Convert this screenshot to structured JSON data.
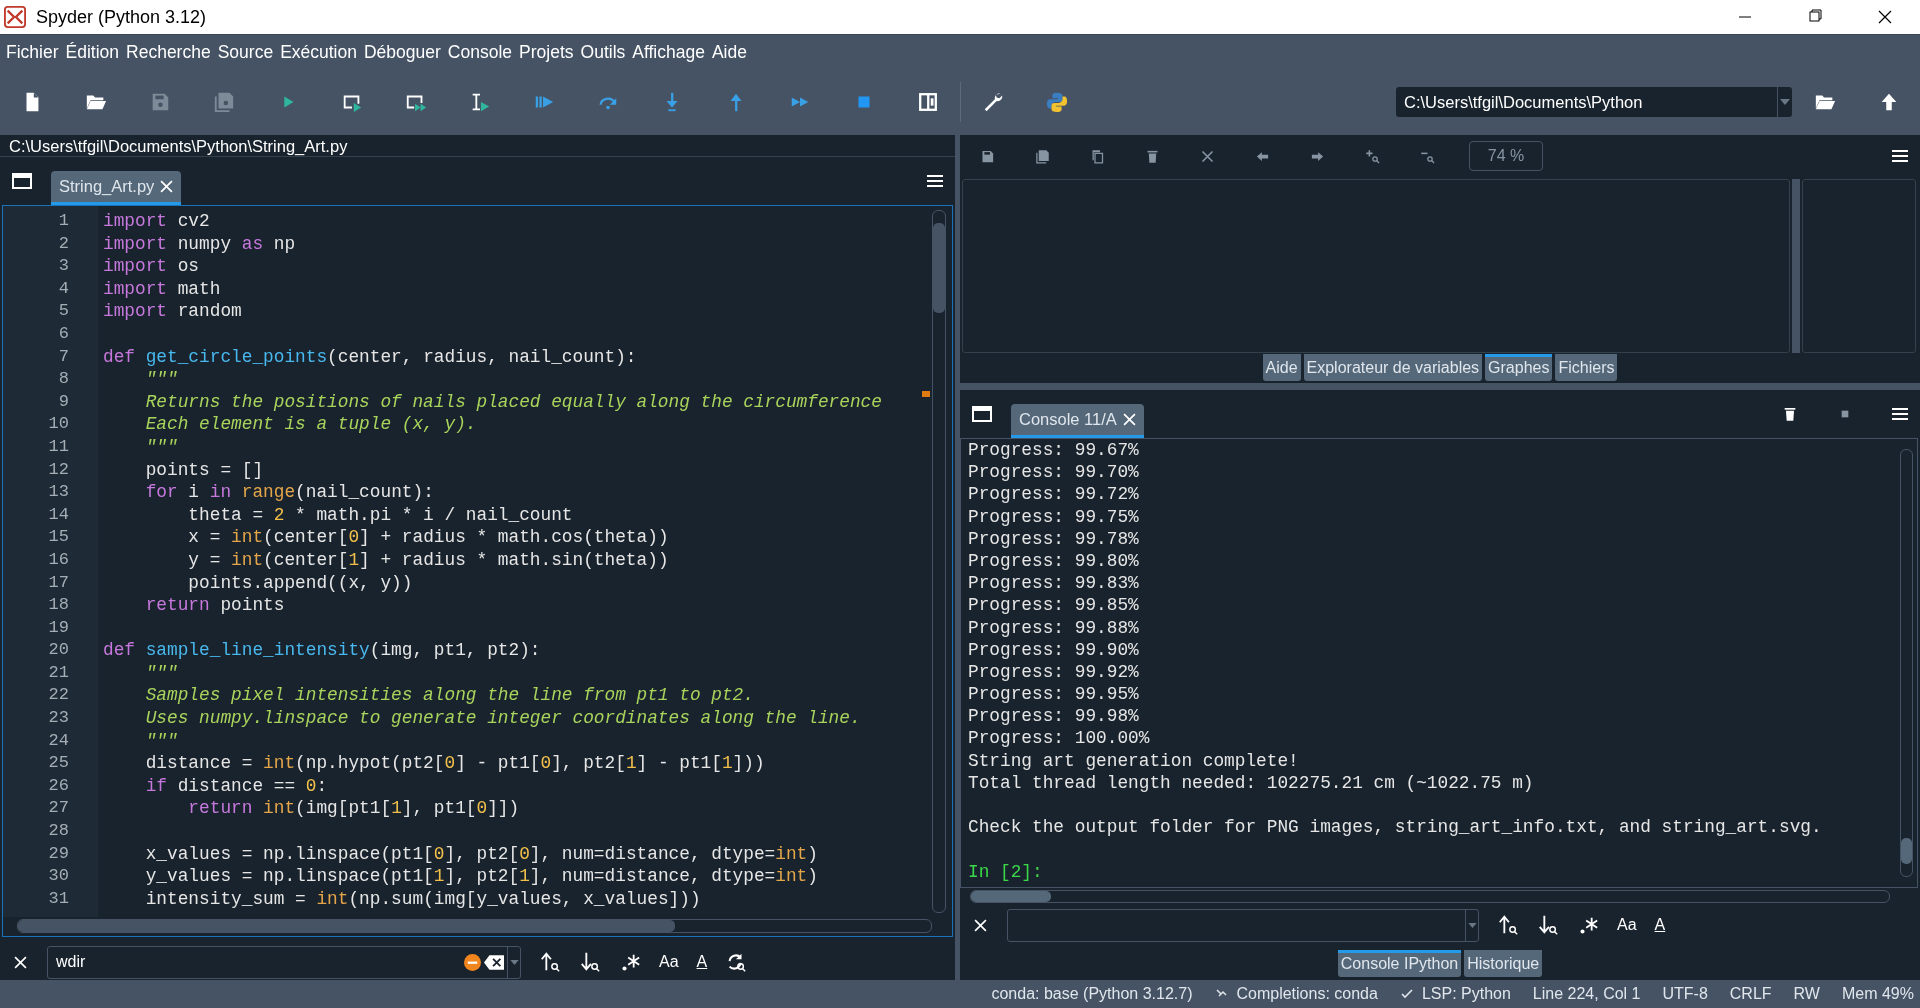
{
  "window": {
    "title": "Spyder (Python 3.12)"
  },
  "menu": [
    "Fichier",
    "Édition",
    "Recherche",
    "Source",
    "Exécution",
    "Déboguer",
    "Console",
    "Projets",
    "Outils",
    "Affichage",
    "Aide"
  ],
  "working_directory": {
    "value": "C:\\Users\\tfgil\\Documents\\Python"
  },
  "editor": {
    "path": "C:\\Users\\tfgil\\Documents\\Python\\String_Art.py",
    "tabs": [
      {
        "label": "String_Art.py",
        "selected": true
      }
    ],
    "lines": [
      {
        "n": "1",
        "tokens": [
          {
            "kind": "kw",
            "text": "import"
          },
          {
            "kind": "p",
            "text": " cv2"
          }
        ]
      },
      {
        "n": "2",
        "tokens": [
          {
            "kind": "kw",
            "text": "import"
          },
          {
            "kind": "p",
            "text": " numpy "
          },
          {
            "kind": "kw",
            "text": "as"
          },
          {
            "kind": "p",
            "text": " np"
          }
        ]
      },
      {
        "n": "3",
        "tokens": [
          {
            "kind": "kw",
            "text": "import"
          },
          {
            "kind": "p",
            "text": " os"
          }
        ]
      },
      {
        "n": "4",
        "tokens": [
          {
            "kind": "kw",
            "text": "import"
          },
          {
            "kind": "p",
            "text": " math"
          }
        ]
      },
      {
        "n": "5",
        "tokens": [
          {
            "kind": "kw",
            "text": "import"
          },
          {
            "kind": "p",
            "text": " random"
          }
        ]
      },
      {
        "n": "6"
      },
      {
        "n": "7",
        "tokens": [
          {
            "kind": "kw",
            "text": "def "
          },
          {
            "kind": "fn",
            "text": "get_circle_points"
          },
          {
            "kind": "p",
            "text": "(center, radius, nail_count):"
          }
        ]
      },
      {
        "n": "8",
        "tokens": [
          {
            "kind": "doc",
            "text": "    \"\"\""
          }
        ]
      },
      {
        "n": "9",
        "tokens": [
          {
            "kind": "doc",
            "text": "    Returns the positions of nails placed equally along the circumference"
          }
        ]
      },
      {
        "n": "10",
        "tokens": [
          {
            "kind": "doc",
            "text": "    Each element is a tuple (x, y)."
          }
        ]
      },
      {
        "n": "11",
        "tokens": [
          {
            "kind": "doc",
            "text": "    \"\"\""
          }
        ]
      },
      {
        "n": "12",
        "tokens": [
          {
            "kind": "p",
            "text": "    points = []"
          }
        ]
      },
      {
        "n": "13",
        "tokens": [
          {
            "kind": "kw",
            "text": "    for"
          },
          {
            "kind": "p",
            "text": " i "
          },
          {
            "kind": "kw",
            "text": "in"
          },
          {
            "kind": "bi",
            "text": " range"
          },
          {
            "kind": "p",
            "text": "(nail_count):"
          }
        ]
      },
      {
        "n": "14",
        "tokens": [
          {
            "kind": "p",
            "text": "        theta = "
          },
          {
            "kind": "num",
            "text": "2"
          },
          {
            "kind": "p",
            "text": " * math.pi * i / nail_count"
          }
        ]
      },
      {
        "n": "15",
        "tokens": [
          {
            "kind": "p",
            "text": "        x = "
          },
          {
            "kind": "bi",
            "text": "int"
          },
          {
            "kind": "p",
            "text": "(center["
          },
          {
            "kind": "num",
            "text": "0"
          },
          {
            "kind": "p",
            "text": "] + radius * math.cos(theta))"
          }
        ]
      },
      {
        "n": "16",
        "tokens": [
          {
            "kind": "p",
            "text": "        y = "
          },
          {
            "kind": "bi",
            "text": "int"
          },
          {
            "kind": "p",
            "text": "(center["
          },
          {
            "kind": "num",
            "text": "1"
          },
          {
            "kind": "p",
            "text": "] + radius * math.sin(theta))"
          }
        ]
      },
      {
        "n": "17",
        "tokens": [
          {
            "kind": "p",
            "text": "        points.append((x, y))"
          }
        ]
      },
      {
        "n": "18",
        "tokens": [
          {
            "kind": "kw",
            "text": "    return"
          },
          {
            "kind": "p",
            "text": " points"
          }
        ]
      },
      {
        "n": "19"
      },
      {
        "n": "20",
        "tokens": [
          {
            "kind": "kw",
            "text": "def "
          },
          {
            "kind": "fn",
            "text": "sample_line_intensity"
          },
          {
            "kind": "p",
            "text": "(img, pt1, pt2):"
          }
        ]
      },
      {
        "n": "21",
        "tokens": [
          {
            "kind": "doc",
            "text": "    \"\"\""
          }
        ]
      },
      {
        "n": "22",
        "tokens": [
          {
            "kind": "doc",
            "text": "    Samples pixel intensities along the line from pt1 to pt2."
          }
        ]
      },
      {
        "n": "23",
        "tokens": [
          {
            "kind": "doc",
            "text": "    Uses numpy.linspace to generate integer coordinates along the line."
          }
        ]
      },
      {
        "n": "24",
        "tokens": [
          {
            "kind": "doc",
            "text": "    \"\"\""
          }
        ]
      },
      {
        "n": "25",
        "tokens": [
          {
            "kind": "p",
            "text": "    distance = "
          },
          {
            "kind": "bi",
            "text": "int"
          },
          {
            "kind": "p",
            "text": "(np.hypot(pt2["
          },
          {
            "kind": "num",
            "text": "0"
          },
          {
            "kind": "p",
            "text": "] - pt1["
          },
          {
            "kind": "num",
            "text": "0"
          },
          {
            "kind": "p",
            "text": "], pt2["
          },
          {
            "kind": "num",
            "text": "1"
          },
          {
            "kind": "p",
            "text": "] - pt1["
          },
          {
            "kind": "num",
            "text": "1"
          },
          {
            "kind": "p",
            "text": "]))"
          }
        ]
      },
      {
        "n": "26",
        "tokens": [
          {
            "kind": "kw",
            "text": "    if"
          },
          {
            "kind": "p",
            "text": " distance == "
          },
          {
            "kind": "num",
            "text": "0"
          },
          {
            "kind": "p",
            "text": ":"
          }
        ]
      },
      {
        "n": "27",
        "tokens": [
          {
            "kind": "kw",
            "text": "        return"
          },
          {
            "kind": "bi",
            "text": " int"
          },
          {
            "kind": "p",
            "text": "(img[pt1["
          },
          {
            "kind": "num",
            "text": "1"
          },
          {
            "kind": "p",
            "text": "], pt1["
          },
          {
            "kind": "num",
            "text": "0"
          },
          {
            "kind": "p",
            "text": "]])"
          }
        ]
      },
      {
        "n": "28"
      },
      {
        "n": "29",
        "tokens": [
          {
            "kind": "p",
            "text": "    x_values = np.linspace(pt1["
          },
          {
            "kind": "num",
            "text": "0"
          },
          {
            "kind": "p",
            "text": "], pt2["
          },
          {
            "kind": "num",
            "text": "0"
          },
          {
            "kind": "p",
            "text": "], num=distance, dtype="
          },
          {
            "kind": "bi",
            "text": "int"
          },
          {
            "kind": "p",
            "text": ")"
          }
        ]
      },
      {
        "n": "30",
        "tokens": [
          {
            "kind": "p",
            "text": "    y_values = np.linspace(pt1["
          },
          {
            "kind": "num",
            "text": "1"
          },
          {
            "kind": "p",
            "text": "], pt2["
          },
          {
            "kind": "num",
            "text": "1"
          },
          {
            "kind": "p",
            "text": "], num=distance, dtype="
          },
          {
            "kind": "bi",
            "text": "int"
          },
          {
            "kind": "p",
            "text": ")"
          }
        ]
      },
      {
        "n": "31",
        "tokens": [
          {
            "kind": "p",
            "text": "    intensity_sum = "
          },
          {
            "kind": "bi",
            "text": "int"
          },
          {
            "kind": "p",
            "text": "(np.sum(img[y_values, x_values]))"
          }
        ]
      }
    ],
    "find": {
      "value": "wdir",
      "case_label": "Aa",
      "word_label": "A"
    }
  },
  "plots": {
    "zoom": "74 %"
  },
  "top_tabs": [
    {
      "label": "Aide",
      "selected": false
    },
    {
      "label": "Explorateur de variables",
      "selected": false
    },
    {
      "label": "Graphes",
      "selected": true
    },
    {
      "label": "Fichiers",
      "selected": false
    }
  ],
  "console": {
    "tabs": [
      {
        "label": "Console 11/A",
        "selected": true
      }
    ],
    "lines": [
      {
        "kind": "out",
        "text": "Progress: 99.67%"
      },
      {
        "kind": "out",
        "text": "Progress: 99.70%"
      },
      {
        "kind": "out",
        "text": "Progress: 99.72%"
      },
      {
        "kind": "out",
        "text": "Progress: 99.75%"
      },
      {
        "kind": "out",
        "text": "Progress: 99.78%"
      },
      {
        "kind": "out",
        "text": "Progress: 99.80%"
      },
      {
        "kind": "out",
        "text": "Progress: 99.83%"
      },
      {
        "kind": "out",
        "text": "Progress: 99.85%"
      },
      {
        "kind": "out",
        "text": "Progress: 99.88%"
      },
      {
        "kind": "out",
        "text": "Progress: 99.90%"
      },
      {
        "kind": "out",
        "text": "Progress: 99.92%"
      },
      {
        "kind": "out",
        "text": "Progress: 99.95%"
      },
      {
        "kind": "out",
        "text": "Progress: 99.98%"
      },
      {
        "kind": "out",
        "text": "Progress: 100.00%"
      },
      {
        "kind": "out",
        "text": "String art generation complete!"
      },
      {
        "kind": "out",
        "text": "Total thread length needed: 102275.21 cm (~1022.75 m)"
      },
      {
        "kind": "blank"
      },
      {
        "kind": "out",
        "text": "Check the output folder for PNG images, string_art_info.txt, and string_art.svg."
      },
      {
        "kind": "blank"
      },
      {
        "kind": "prompt",
        "text": "In [2]:"
      }
    ],
    "find": {
      "case_label": "Aa",
      "word_label": "A"
    }
  },
  "bottom_tabs": [
    {
      "label": "Console IPython",
      "selected": true
    },
    {
      "label": "Historique",
      "selected": false
    }
  ],
  "status_bar": [
    {
      "kind": "text",
      "text": "conda: base (Python 3.12.7)"
    },
    {
      "kind": "completions",
      "text": "Completions: conda"
    },
    {
      "kind": "check",
      "text": "LSP: Python"
    },
    {
      "kind": "text",
      "text": "Line 224, Col 1"
    },
    {
      "kind": "text",
      "text": "UTF-8"
    },
    {
      "kind": "text",
      "text": "CRLF"
    },
    {
      "kind": "text",
      "text": "RW"
    },
    {
      "kind": "text",
      "text": "Mem 49%"
    }
  ]
}
